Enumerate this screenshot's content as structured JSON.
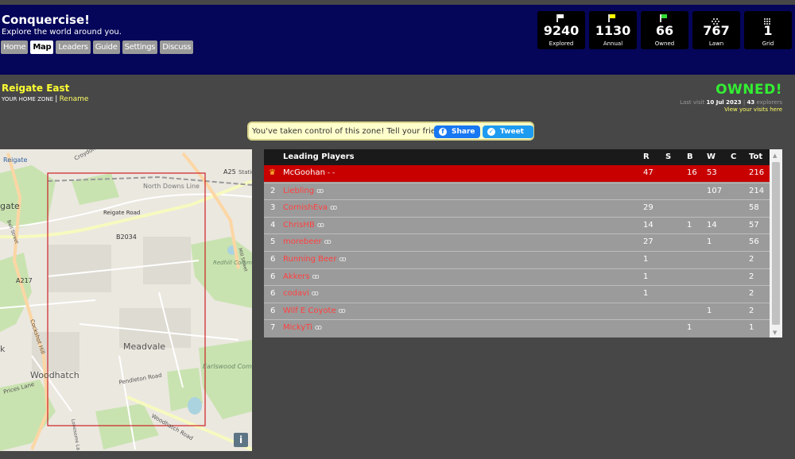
{
  "brand": {
    "title": "Conquercise!",
    "subtitle": "Explore the world around you."
  },
  "nav": [
    {
      "label": "Home",
      "active": false
    },
    {
      "label": "Map",
      "active": true
    },
    {
      "label": "Leaders",
      "active": false
    },
    {
      "label": "Guide",
      "active": false
    },
    {
      "label": "Settings",
      "active": false
    },
    {
      "label": "Discuss",
      "active": false
    }
  ],
  "stats": [
    {
      "value": "9240",
      "label": "Explored",
      "flag_color": "#ffffff"
    },
    {
      "value": "1130",
      "label": "Annual",
      "flag_color": "#ffff00"
    },
    {
      "value": "66",
      "label": "Owned",
      "flag_color": "#33dd33"
    },
    {
      "value": "767",
      "label": "Lawn",
      "flag_color": "#bbbbbb"
    },
    {
      "value": "1",
      "label": "Grid",
      "flag_color": "#bbbbbb"
    }
  ],
  "zone": {
    "name": "Reigate East",
    "home_label": "YOUR HOME ZONE",
    "separator": "|",
    "rename": "Rename",
    "status": "OWNED!",
    "last_visit_prefix": "Last visit",
    "last_visit_date": "10 Jul 2023",
    "explorers_count": "43",
    "explorers_label": "explorers",
    "visits_link": "View your visits here"
  },
  "share": {
    "text": "You've taken control of this zone! Tell your friends:",
    "facebook": "Share",
    "twitter": "Tweet"
  },
  "map": {
    "labels": {
      "reigate": "Reigate",
      "croydon": "Croydon",
      "a25": "A25",
      "station": "Station",
      "north_downs": "North Downs Line",
      "gate": "gate",
      "reigate_road": "Reigate Road",
      "bell_street": "Bell Street",
      "b2034": "B2034",
      "mill_street": "Mill Street",
      "redhill_common": "Redhill Common",
      "a217": "A217",
      "cockshot_hill": "Cockshot Hill",
      "meadvale": "Meadvale",
      "k": "k",
      "earlswood_common": "Earlswood Common",
      "woodhatch": "Woodhatch",
      "pendleton_road": "Pendleton Road",
      "prices_lane": "Prices Lane",
      "woodhatch_road": "Woodhatch Road",
      "lonesome_lane": "Lonesome La"
    },
    "info_button": "i"
  },
  "table": {
    "headers": {
      "players": "Leading Players",
      "r": "R",
      "s": "S",
      "b": "B",
      "w": "W",
      "c": "C",
      "tot": "Tot"
    },
    "rows": [
      {
        "rank": "",
        "name": "McGoohan",
        "suffix": "- -",
        "r": "47",
        "s": "",
        "b": "16",
        "w": "53",
        "c": "",
        "tot": "216"
      },
      {
        "rank": "2",
        "name": "Liebling",
        "suffix": "ꝏ",
        "r": "",
        "s": "",
        "b": "",
        "w": "107",
        "c": "",
        "tot": "214"
      },
      {
        "rank": "3",
        "name": "CornishEva",
        "suffix": "ꝏ",
        "r": "29",
        "s": "",
        "b": "",
        "w": "",
        "c": "",
        "tot": "58"
      },
      {
        "rank": "4",
        "name": "ChrisHB",
        "suffix": "ꝏ",
        "r": "14",
        "s": "",
        "b": "1",
        "w": "14",
        "c": "",
        "tot": "57"
      },
      {
        "rank": "5",
        "name": "morebeer",
        "suffix": "ꝏ",
        "r": "27",
        "s": "",
        "b": "",
        "w": "1",
        "c": "",
        "tot": "56"
      },
      {
        "rank": "6",
        "name": "Running Beer",
        "suffix": "ꝏ",
        "r": "1",
        "s": "",
        "b": "",
        "w": "",
        "c": "",
        "tot": "2"
      },
      {
        "rank": "6",
        "name": "Akkers",
        "suffix": "ꝏ",
        "r": "1",
        "s": "",
        "b": "",
        "w": "",
        "c": "",
        "tot": "2"
      },
      {
        "rank": "6",
        "name": "codavi",
        "suffix": "ꝏ",
        "r": "1",
        "s": "",
        "b": "",
        "w": "",
        "c": "",
        "tot": "2"
      },
      {
        "rank": "6",
        "name": "Wilf E Coyote",
        "suffix": "ꝏ",
        "r": "",
        "s": "",
        "b": "",
        "w": "1",
        "c": "",
        "tot": "2"
      },
      {
        "rank": "7",
        "name": "MickyTi",
        "suffix": "ꝏ",
        "r": "",
        "s": "",
        "b": "1",
        "w": "",
        "c": "",
        "tot": "1"
      }
    ]
  }
}
